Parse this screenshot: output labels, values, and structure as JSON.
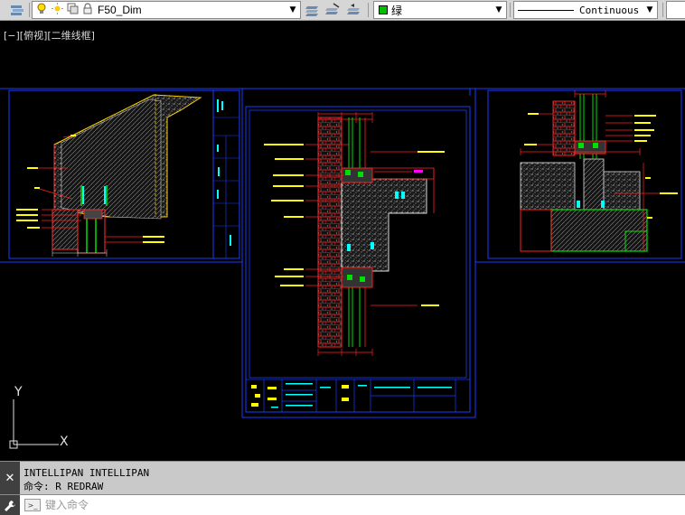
{
  "toolbar": {
    "layer_name": "F50_Dim",
    "color_name": "绿",
    "color_swatch": "#00c000",
    "linetype": "Continuous",
    "icons": [
      "layer-properties-icon",
      "bulb-icon",
      "sun-icon",
      "lock-icon",
      "layer-color-icon",
      "layer-states-icon",
      "layer-match-icon"
    ]
  },
  "viewport": {
    "label": "[−][俯视][二维线框]"
  },
  "drawing_colors": {
    "frame": "#0033ff",
    "red": "#ff2020",
    "yellow": "#ffff00",
    "green": "#00e000",
    "cyan": "#00ffff",
    "white": "#e0e0e0"
  },
  "ucs": {
    "x_label": "X",
    "y_label": "Y"
  },
  "command": {
    "history": [
      "INTELLIPAN INTELLIPAN",
      "命令: R REDRAW"
    ],
    "placeholder": "键入命令"
  }
}
